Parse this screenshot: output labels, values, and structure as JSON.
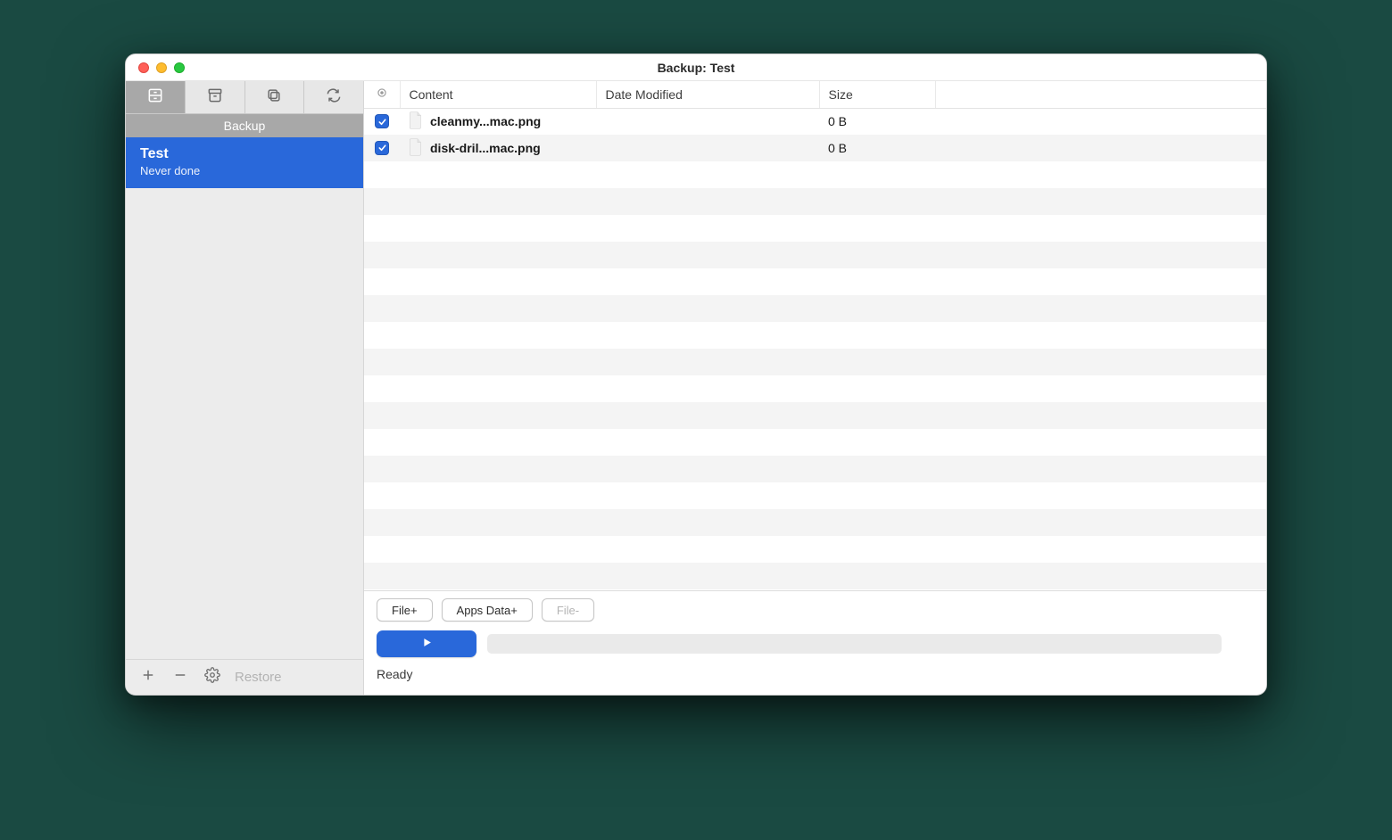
{
  "window": {
    "title": "Backup: Test"
  },
  "sidebar": {
    "header": "Backup",
    "items": [
      {
        "name": "Test",
        "subtitle": "Never done"
      }
    ],
    "footer": {
      "restore_label": "Restore"
    }
  },
  "table": {
    "columns": {
      "content": "Content",
      "date": "Date Modified",
      "size": "Size"
    },
    "rows": [
      {
        "checked": true,
        "name": "cleanmy...mac.png",
        "date": "",
        "size": "0 B"
      },
      {
        "checked": true,
        "name": "disk-dril...mac.png",
        "date": "",
        "size": "0 B"
      }
    ],
    "blank_rows": 16
  },
  "bottom": {
    "file_plus": "File+",
    "apps_data_plus": "Apps Data+",
    "file_minus": "File-",
    "status": "Ready"
  }
}
